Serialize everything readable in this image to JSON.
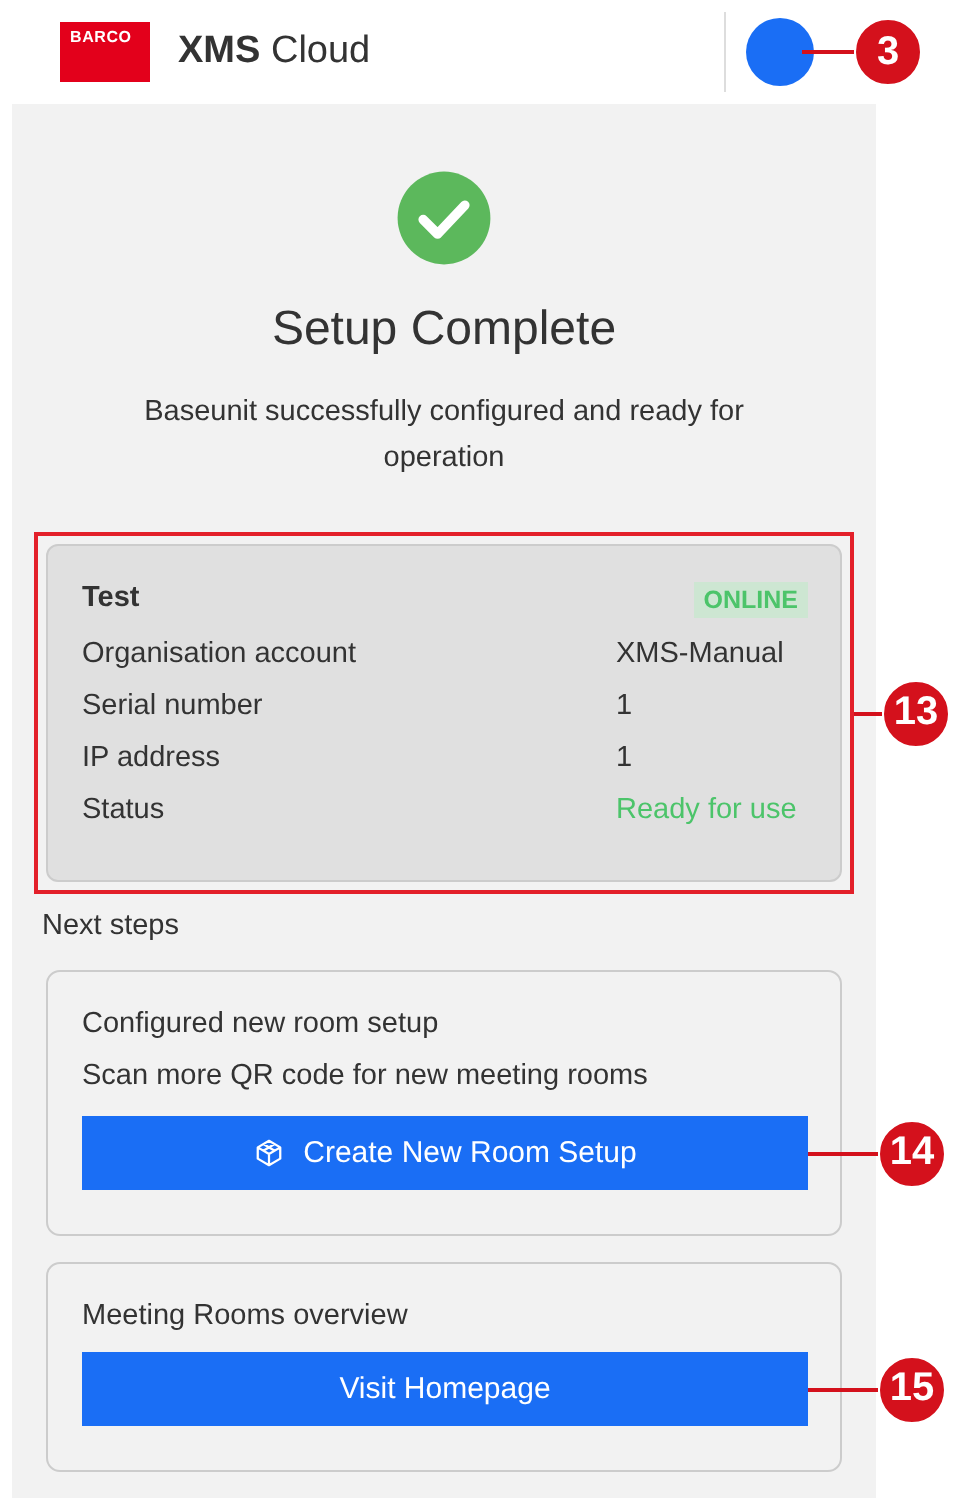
{
  "header": {
    "logo_text": "BARCO",
    "app_name_bold": "XMS",
    "app_name": "Cloud",
    "callout": "3"
  },
  "setup": {
    "title": "Setup Complete",
    "message": "Baseunit successfully configured and ready for operation"
  },
  "device_card": {
    "name": "Test",
    "badge": "ONLINE",
    "callout": "13",
    "rows": [
      {
        "label": "Organisation account",
        "value": "XMS-Manual",
        "kind": "plain"
      },
      {
        "label": "Serial number",
        "value": "1",
        "kind": "plain"
      },
      {
        "label": "IP address",
        "value": "1",
        "kind": "plain"
      },
      {
        "label": "Status",
        "value": "Ready for use",
        "kind": "success"
      }
    ]
  },
  "next_steps": {
    "heading": "Next steps",
    "cards": [
      {
        "title": "Configured new room setup",
        "description": "Scan more QR code for new meeting rooms",
        "button": "Create New Room Setup",
        "icon": true,
        "callout": "14"
      },
      {
        "title": "Meeting Rooms overview",
        "button": "Visit Homepage",
        "icon": false,
        "callout": "15"
      }
    ]
  }
}
